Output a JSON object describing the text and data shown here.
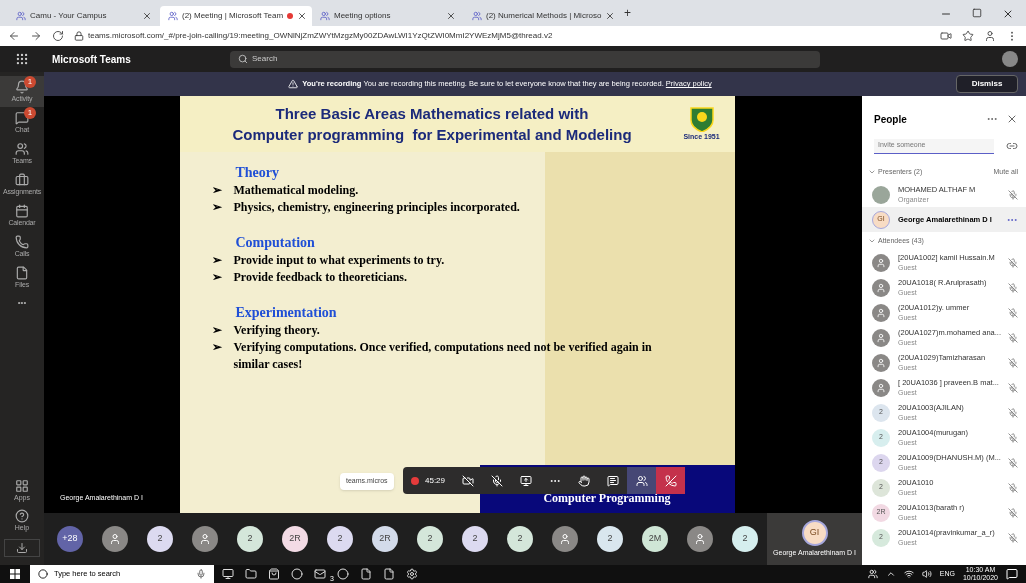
{
  "browser": {
    "tabs": [
      {
        "title": "Camu - Your Campus",
        "selected": false,
        "recording": false
      },
      {
        "title": "(2) Meeting | Microsoft Team",
        "selected": true,
        "recording": true
      },
      {
        "title": "Meeting options",
        "selected": false,
        "recording": false
      },
      {
        "title": "(2) Numerical Methods | Microso",
        "selected": false,
        "recording": false
      }
    ],
    "new_tab": "+",
    "url": "teams.microsoft.com/_#/pre-join-calling/19:meeting_OWNlNjZmZWYtMzgzMy00ZDAwLWI1YzQtZWI0MmI2YWEzMjM5@thread.v2"
  },
  "teams": {
    "app_name": "Microsoft Teams",
    "search_placeholder": "Search"
  },
  "banner": {
    "bold": "You're recording",
    "text": "You are recording this meeting. Be sure to let everyone know that they are being recorded.",
    "link": "Privacy policy",
    "button": "Dismiss"
  },
  "rail": {
    "items": [
      {
        "label": "Activity",
        "badge": "1"
      },
      {
        "label": "Chat",
        "badge": "1"
      },
      {
        "label": "Teams"
      },
      {
        "label": "Assignments"
      },
      {
        "label": "Calendar"
      },
      {
        "label": "Calls"
      },
      {
        "label": "Files"
      }
    ],
    "more": "•••",
    "bottom_items": [
      {
        "label": "Apps"
      },
      {
        "label": "Help"
      }
    ]
  },
  "slide": {
    "title_lines": [
      "Three Basic Areas Mathematics related with",
      "Computer programming  for Experimental and Modeling"
    ],
    "logo_caption": "Since 1951",
    "sections": [
      {
        "heading": "Theory",
        "bullets": [
          {
            "marker": "➢",
            "text": "Mathematical modeling."
          },
          {
            "marker": "➢",
            "text": "Physics, chemistry, engineering principles incorporated."
          }
        ]
      },
      {
        "heading": "Computation",
        "bullets": [
          {
            "marker": "➢",
            "text": "Provide input to what experiments to try."
          },
          {
            "marker": "➢",
            "text": "Provide feedback to theoreticians."
          }
        ]
      },
      {
        "heading": "Experimentation",
        "bullets": [
          {
            "marker": "➢",
            "text": "Verifying theory."
          },
          {
            "marker": "➢",
            "text": "Verifying computations.  Once verified, computations need not be verified again in similar cases!"
          }
        ]
      }
    ],
    "footer_text": "Computer Programming"
  },
  "presenter_label": "George Amalarethinam D I",
  "share_chip": "teams.micros",
  "call_controls": {
    "recording": true,
    "timer": "45:29",
    "buttons": [
      {
        "selected": false
      },
      {
        "selected": false
      },
      {
        "selected": false
      },
      {
        "selected": false
      },
      {
        "selected": false
      },
      {
        "selected": false
      },
      {
        "selected": true
      },
      {
        "selected": false
      }
    ]
  },
  "people": {
    "title": "People",
    "invite_placeholder": "Invite someone",
    "presenters_header": "Presenters (2)",
    "mute_all": "Mute all",
    "presenters": [
      {
        "kind": "photo",
        "name": "MOHAMED ALTHAF M",
        "role": "Organizer",
        "selected": false
      },
      {
        "kind": "initials",
        "initials": "GI",
        "name": "George Amalarethinam D I",
        "selected": true
      }
    ],
    "attendees_header": "Attendees (43)",
    "attendees": [
      {
        "kind": "person",
        "name": "[20UA1002] kamil  Hussain.M",
        "role": "Guest"
      },
      {
        "kind": "person",
        "name": "20UA1018( R.Arulprasath)",
        "role": "Guest"
      },
      {
        "kind": "person",
        "name": "(20UA1012)y. ummer",
        "role": "Guest"
      },
      {
        "kind": "person",
        "name": "(20UA1027)m.mohamed ana...",
        "role": "Guest"
      },
      {
        "kind": "person",
        "name": "(20UA1029)Tamizharasan",
        "role": "Guest"
      },
      {
        "kind": "person",
        "name": "[ 20UA1036 ] praveen.B mat...",
        "role": "Guest"
      },
      {
        "kind": "initials",
        "initials": "2",
        "color": "#dce5ee",
        "name": "20UA1003(AJILAN)",
        "role": "Guest"
      },
      {
        "kind": "initials",
        "initials": "2",
        "color": "#d7eeee",
        "name": "20UA1004(murugan)",
        "role": "Guest"
      },
      {
        "kind": "initials",
        "initials": "2",
        "color": "#dcd6ee",
        "name": "20UA1009(DHANUSH.M) (M...",
        "role": "Guest"
      },
      {
        "kind": "initials",
        "initials": "2",
        "color": "#dde5d9",
        "name": "20UA1010",
        "role": "Guest"
      },
      {
        "kind": "initials",
        "initials": "2R",
        "color": "#f2d9e3",
        "name": "20UA1013(barath r)",
        "role": "Guest"
      },
      {
        "kind": "initials",
        "initials": "2",
        "color": "#d6e9dc",
        "name": "20UA1014(pravinkumar_a_r)",
        "role": "Guest"
      }
    ]
  },
  "strip": {
    "avatars": [
      {
        "kind": "initials",
        "label": "+28",
        "color": "#6264a7"
      },
      {
        "kind": "person",
        "color": "#8a8886"
      },
      {
        "kind": "initials",
        "label": "2",
        "color": "#dcdaf0"
      },
      {
        "kind": "person",
        "color": "#8a8886"
      },
      {
        "kind": "initials",
        "label": "2",
        "color": "#d4e6da"
      },
      {
        "kind": "initials",
        "label": "2R",
        "color": "#f3dbe5"
      },
      {
        "kind": "initials",
        "label": "2",
        "color": "#dcdaf0"
      },
      {
        "kind": "initials",
        "label": "2R",
        "color": "#d3dbea"
      },
      {
        "kind": "initials",
        "label": "2",
        "color": "#d4e6da"
      },
      {
        "kind": "initials",
        "label": "2",
        "color": "#dcdaf0"
      },
      {
        "kind": "initials",
        "label": "2",
        "color": "#d4e6da"
      },
      {
        "kind": "person",
        "color": "#8a8886"
      },
      {
        "kind": "initials",
        "label": "2",
        "color": "#d9e6ee"
      },
      {
        "kind": "initials",
        "label": "2M",
        "color": "#cfe6d6"
      },
      {
        "kind": "person",
        "color": "#8a8886"
      },
      {
        "kind": "initials",
        "label": "2",
        "color": "#d5eeee"
      }
    ],
    "self": {
      "initials": "GI",
      "name": "George Amalarethinam D I"
    }
  },
  "taskbar": {
    "search_placeholder": "Type here to search",
    "mail_badge": "3",
    "language": "ENG",
    "time": "10:30 AM",
    "date": "10/10/2020"
  }
}
